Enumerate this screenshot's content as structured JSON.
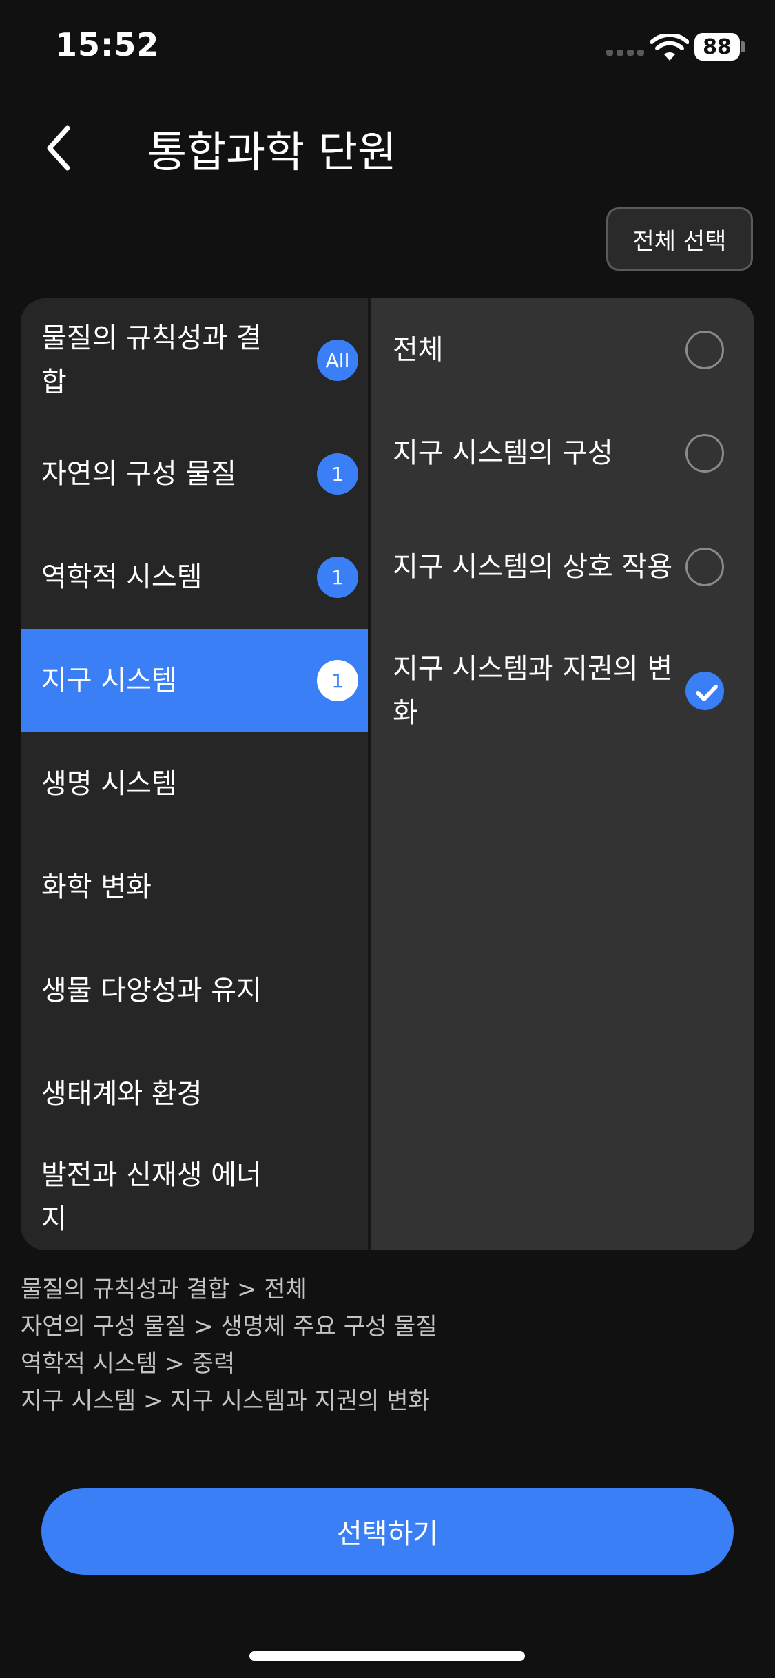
{
  "status_bar": {
    "time": "15:52",
    "battery": "88"
  },
  "header": {
    "title": "통합과학 단원",
    "back_icon": "chevron-left-icon"
  },
  "select_all_label": "전체 선택",
  "units": [
    {
      "label": "물질의 규칙성과 결합",
      "badge": "All",
      "selected": false
    },
    {
      "label": "자연의 구성 물질",
      "badge": "1",
      "selected": false
    },
    {
      "label": "역학적 시스템",
      "badge": "1",
      "selected": false
    },
    {
      "label": "지구 시스템",
      "badge": "1",
      "selected": true
    },
    {
      "label": "생명 시스템",
      "badge": "",
      "selected": false
    },
    {
      "label": "화학 변화",
      "badge": "",
      "selected": false
    },
    {
      "label": "생물 다양성과 유지",
      "badge": "",
      "selected": false
    },
    {
      "label": "생태계와 환경",
      "badge": "",
      "selected": false
    },
    {
      "label": "발전과 신재생 에너지",
      "badge": "",
      "selected": false
    }
  ],
  "topics": [
    {
      "label": "전체",
      "checked": false
    },
    {
      "label": "지구 시스템의 구성",
      "checked": false
    },
    {
      "label": "지구 시스템의 상호 작용",
      "checked": false
    },
    {
      "label": "지구 시스템과 지권의 변화",
      "checked": true
    }
  ],
  "summary": [
    "물질의 규칙성과 결합 > 전체",
    "자연의 구성 물질 > 생명체 주요 구성 물질",
    "역학적 시스템 > 중력",
    "지구 시스템 > 지구 시스템과 지권의 변화"
  ],
  "confirm_label": "선택하기",
  "colors": {
    "accent": "#3a7ff6",
    "background": "#111111",
    "panel_left": "#262626",
    "panel_right": "#333333"
  }
}
